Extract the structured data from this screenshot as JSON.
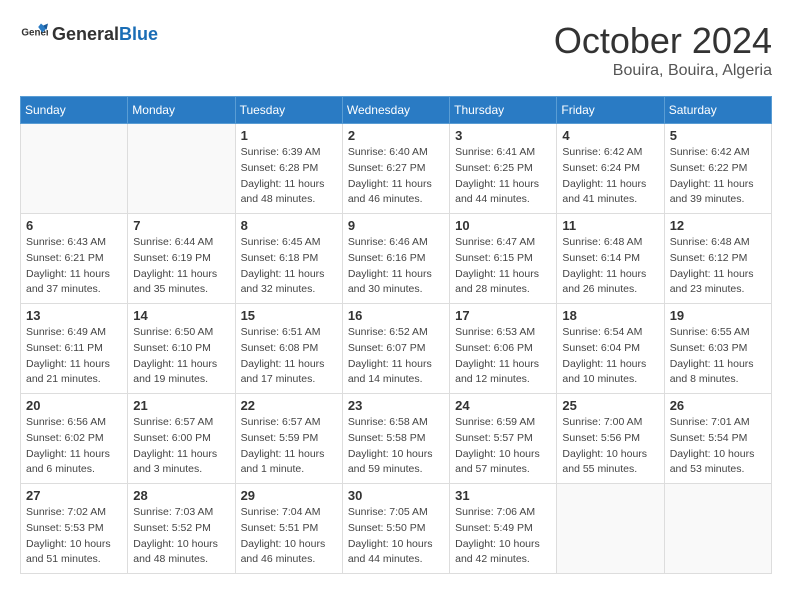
{
  "header": {
    "logo_general": "General",
    "logo_blue": "Blue",
    "month": "October 2024",
    "location": "Bouira, Bouira, Algeria"
  },
  "calendar": {
    "days_of_week": [
      "Sunday",
      "Monday",
      "Tuesday",
      "Wednesday",
      "Thursday",
      "Friday",
      "Saturday"
    ],
    "weeks": [
      [
        {
          "day": "",
          "info": ""
        },
        {
          "day": "",
          "info": ""
        },
        {
          "day": "1",
          "info": "Sunrise: 6:39 AM\nSunset: 6:28 PM\nDaylight: 11 hours and 48 minutes."
        },
        {
          "day": "2",
          "info": "Sunrise: 6:40 AM\nSunset: 6:27 PM\nDaylight: 11 hours and 46 minutes."
        },
        {
          "day": "3",
          "info": "Sunrise: 6:41 AM\nSunset: 6:25 PM\nDaylight: 11 hours and 44 minutes."
        },
        {
          "day": "4",
          "info": "Sunrise: 6:42 AM\nSunset: 6:24 PM\nDaylight: 11 hours and 41 minutes."
        },
        {
          "day": "5",
          "info": "Sunrise: 6:42 AM\nSunset: 6:22 PM\nDaylight: 11 hours and 39 minutes."
        }
      ],
      [
        {
          "day": "6",
          "info": "Sunrise: 6:43 AM\nSunset: 6:21 PM\nDaylight: 11 hours and 37 minutes."
        },
        {
          "day": "7",
          "info": "Sunrise: 6:44 AM\nSunset: 6:19 PM\nDaylight: 11 hours and 35 minutes."
        },
        {
          "day": "8",
          "info": "Sunrise: 6:45 AM\nSunset: 6:18 PM\nDaylight: 11 hours and 32 minutes."
        },
        {
          "day": "9",
          "info": "Sunrise: 6:46 AM\nSunset: 6:16 PM\nDaylight: 11 hours and 30 minutes."
        },
        {
          "day": "10",
          "info": "Sunrise: 6:47 AM\nSunset: 6:15 PM\nDaylight: 11 hours and 28 minutes."
        },
        {
          "day": "11",
          "info": "Sunrise: 6:48 AM\nSunset: 6:14 PM\nDaylight: 11 hours and 26 minutes."
        },
        {
          "day": "12",
          "info": "Sunrise: 6:48 AM\nSunset: 6:12 PM\nDaylight: 11 hours and 23 minutes."
        }
      ],
      [
        {
          "day": "13",
          "info": "Sunrise: 6:49 AM\nSunset: 6:11 PM\nDaylight: 11 hours and 21 minutes."
        },
        {
          "day": "14",
          "info": "Sunrise: 6:50 AM\nSunset: 6:10 PM\nDaylight: 11 hours and 19 minutes."
        },
        {
          "day": "15",
          "info": "Sunrise: 6:51 AM\nSunset: 6:08 PM\nDaylight: 11 hours and 17 minutes."
        },
        {
          "day": "16",
          "info": "Sunrise: 6:52 AM\nSunset: 6:07 PM\nDaylight: 11 hours and 14 minutes."
        },
        {
          "day": "17",
          "info": "Sunrise: 6:53 AM\nSunset: 6:06 PM\nDaylight: 11 hours and 12 minutes."
        },
        {
          "day": "18",
          "info": "Sunrise: 6:54 AM\nSunset: 6:04 PM\nDaylight: 11 hours and 10 minutes."
        },
        {
          "day": "19",
          "info": "Sunrise: 6:55 AM\nSunset: 6:03 PM\nDaylight: 11 hours and 8 minutes."
        }
      ],
      [
        {
          "day": "20",
          "info": "Sunrise: 6:56 AM\nSunset: 6:02 PM\nDaylight: 11 hours and 6 minutes."
        },
        {
          "day": "21",
          "info": "Sunrise: 6:57 AM\nSunset: 6:00 PM\nDaylight: 11 hours and 3 minutes."
        },
        {
          "day": "22",
          "info": "Sunrise: 6:57 AM\nSunset: 5:59 PM\nDaylight: 11 hours and 1 minute."
        },
        {
          "day": "23",
          "info": "Sunrise: 6:58 AM\nSunset: 5:58 PM\nDaylight: 10 hours and 59 minutes."
        },
        {
          "day": "24",
          "info": "Sunrise: 6:59 AM\nSunset: 5:57 PM\nDaylight: 10 hours and 57 minutes."
        },
        {
          "day": "25",
          "info": "Sunrise: 7:00 AM\nSunset: 5:56 PM\nDaylight: 10 hours and 55 minutes."
        },
        {
          "day": "26",
          "info": "Sunrise: 7:01 AM\nSunset: 5:54 PM\nDaylight: 10 hours and 53 minutes."
        }
      ],
      [
        {
          "day": "27",
          "info": "Sunrise: 7:02 AM\nSunset: 5:53 PM\nDaylight: 10 hours and 51 minutes."
        },
        {
          "day": "28",
          "info": "Sunrise: 7:03 AM\nSunset: 5:52 PM\nDaylight: 10 hours and 48 minutes."
        },
        {
          "day": "29",
          "info": "Sunrise: 7:04 AM\nSunset: 5:51 PM\nDaylight: 10 hours and 46 minutes."
        },
        {
          "day": "30",
          "info": "Sunrise: 7:05 AM\nSunset: 5:50 PM\nDaylight: 10 hours and 44 minutes."
        },
        {
          "day": "31",
          "info": "Sunrise: 7:06 AM\nSunset: 5:49 PM\nDaylight: 10 hours and 42 minutes."
        },
        {
          "day": "",
          "info": ""
        },
        {
          "day": "",
          "info": ""
        }
      ]
    ]
  }
}
